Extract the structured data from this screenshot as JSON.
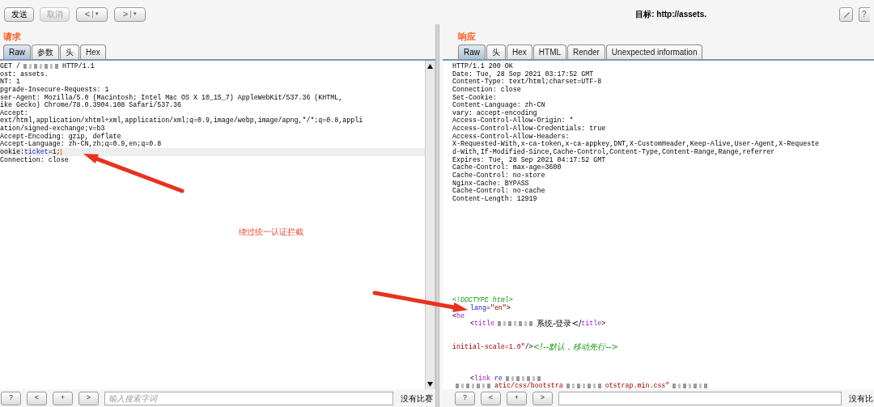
{
  "toolbar": {
    "buttons": [
      {
        "label": "发送",
        "disabled": false
      },
      {
        "label": "取消",
        "disabled": true
      }
    ],
    "nav": [
      {
        "label": "<",
        "menu": "▾"
      },
      {
        "label": ">",
        "menu": "▾"
      }
    ],
    "target": {
      "label": "目标:",
      "url": "http://assets."
    },
    "help": "?"
  },
  "request": {
    "title": "请求",
    "tabs": [
      {
        "label": "Raw",
        "selected": true
      },
      {
        "label": "参数",
        "selected": false
      },
      {
        "label": "头",
        "selected": false
      },
      {
        "label": "Hex",
        "selected": false
      }
    ],
    "lines": [
      {
        "kind": "code",
        "highlighted": false,
        "segments": [
          {
            "kind": "plain",
            "text": "GET /"
          },
          {
            "kind": "redacted"
          },
          {
            "kind": "plain",
            "text": "HTTP/1.1"
          }
        ]
      },
      {
        "kind": "code",
        "highlighted": false,
        "segments": [
          {
            "kind": "plain",
            "text": "ost: assets."
          }
        ]
      },
      {
        "kind": "code",
        "highlighted": false,
        "segments": [
          {
            "kind": "plain",
            "text": "NT: 1"
          }
        ]
      },
      {
        "kind": "code",
        "highlighted": false,
        "segments": [
          {
            "kind": "plain",
            "text": "pgrade-Insecure-Requests: 1"
          }
        ]
      },
      {
        "kind": "code",
        "highlighted": false,
        "segments": [
          {
            "kind": "plain",
            "text": "ser-Agent: Mozilla/5.0 (Macintosh; Intel Mac OS X 10_15_7) AppleWebKit/537.36 (KHTML,"
          }
        ]
      },
      {
        "kind": "code",
        "highlighted": false,
        "segments": [
          {
            "kind": "plain",
            "text": "ike Gecko) Chrome/78.0.3904.108 Safari/537.36"
          }
        ]
      },
      {
        "kind": "code",
        "highlighted": false,
        "segments": [
          {
            "kind": "plain",
            "text": "Accept:"
          }
        ]
      },
      {
        "kind": "code",
        "highlighted": false,
        "segments": [
          {
            "kind": "plain",
            "text": "ext/html,application/xhtml+xml,application/xml;q=0.9,image/webp,image/apng,*/*;q=0.8,appli"
          }
        ]
      },
      {
        "kind": "code",
        "highlighted": false,
        "segments": [
          {
            "kind": "plain",
            "text": "ation/signed-exchange;v=b3"
          }
        ]
      },
      {
        "kind": "code",
        "highlighted": false,
        "segments": [
          {
            "kind": "plain",
            "text": "Accept-Encoding: gzip, deflate"
          }
        ]
      },
      {
        "kind": "code",
        "highlighted": false,
        "segments": [
          {
            "kind": "plain",
            "text": "Accept-Language: zh-CN,zh;q=0.9,en;q=0.8"
          }
        ]
      },
      {
        "kind": "code",
        "highlighted": true,
        "segments": [
          {
            "kind": "plain",
            "text": "ookie:"
          },
          {
            "kind": "attr",
            "text": "ticket"
          },
          {
            "kind": "plain",
            "text": "=1;"
          }
        ]
      },
      {
        "kind": "code",
        "highlighted": false,
        "segments": [
          {
            "kind": "plain",
            "text": "Connection: close"
          }
        ]
      }
    ],
    "search": {
      "buttons": [
        "?",
        "<",
        "+",
        ">"
      ],
      "placeholder": "输入搜索字词",
      "status": "没有比赛"
    }
  },
  "response": {
    "title": "响应",
    "tabs": [
      {
        "label": "Raw",
        "selected": true
      },
      {
        "label": "头",
        "selected": false
      },
      {
        "label": "Hex",
        "selected": false
      },
      {
        "label": "HTML",
        "selected": false
      },
      {
        "label": "Render",
        "selected": false
      },
      {
        "label": "Unexpected information",
        "selected": false
      }
    ],
    "lines": [
      {
        "kind": "code",
        "segments": [
          {
            "kind": "plain",
            "text": "HTTP/1.1 200 OK"
          }
        ]
      },
      {
        "kind": "code",
        "segments": [
          {
            "kind": "plain",
            "text": "Date: Tue, 28 Sep 2021 03:17:52 GMT"
          }
        ]
      },
      {
        "kind": "code",
        "segments": [
          {
            "kind": "plain",
            "text": "Content-Type: text/html;charset=UTF-8"
          }
        ]
      },
      {
        "kind": "code",
        "segments": [
          {
            "kind": "plain",
            "text": "Connection: close"
          }
        ]
      },
      {
        "kind": "code",
        "segments": [
          {
            "kind": "plain",
            "text": "Set-Cookie:"
          }
        ]
      },
      {
        "kind": "code",
        "segments": [
          {
            "kind": "plain",
            "text": "Content-Language: zh-CN"
          }
        ]
      },
      {
        "kind": "code",
        "segments": [
          {
            "kind": "plain",
            "text": "vary: accept-encoding"
          }
        ]
      },
      {
        "kind": "code",
        "segments": [
          {
            "kind": "plain",
            "text": "Access-Control-Allow-Origin: *"
          }
        ]
      },
      {
        "kind": "code",
        "segments": [
          {
            "kind": "plain",
            "text": "Access-Control-Allow-Credentials: true"
          }
        ]
      },
      {
        "kind": "code",
        "segments": [
          {
            "kind": "plain",
            "text": "Access-Control-Allow-Headers:"
          }
        ]
      },
      {
        "kind": "code",
        "segments": [
          {
            "kind": "plain",
            "text": "X-Requested-With,x-ca-token,x-ca-appkey,DNT,X-CustomHeader,Keep-Alive,User-Agent,X-Requeste"
          }
        ]
      },
      {
        "kind": "code",
        "segments": [
          {
            "kind": "plain",
            "text": "d-With,If-Modified-Since,Cache-Control,Content-Type,Content-Range,Range,referrer"
          }
        ]
      },
      {
        "kind": "code",
        "segments": [
          {
            "kind": "plain",
            "text": "Expires: Tue, 28 Sep 2021 04:17:52 GMT"
          }
        ]
      },
      {
        "kind": "code",
        "segments": [
          {
            "kind": "plain",
            "text": "Cache-Control: max-age=3600"
          }
        ]
      },
      {
        "kind": "code",
        "segments": [
          {
            "kind": "plain",
            "text": "Cache-Control: no-store"
          }
        ]
      },
      {
        "kind": "code",
        "segments": [
          {
            "kind": "plain",
            "text": "Nginx-Cache: BYPASS"
          }
        ]
      },
      {
        "kind": "code",
        "segments": [
          {
            "kind": "plain",
            "text": "Cache-Control: no-cache"
          }
        ]
      },
      {
        "kind": "code",
        "segments": [
          {
            "kind": "plain",
            "text": "Content-Length: 12919"
          }
        ]
      },
      {
        "kind": "blank"
      },
      {
        "kind": "blank"
      },
      {
        "kind": "blank"
      },
      {
        "kind": "blank"
      },
      {
        "kind": "blank"
      },
      {
        "kind": "blank"
      },
      {
        "kind": "blank"
      },
      {
        "kind": "blank"
      },
      {
        "kind": "blank"
      },
      {
        "kind": "blank"
      },
      {
        "kind": "blank"
      },
      {
        "kind": "blank"
      },
      {
        "kind": "code",
        "segments": [
          {
            "kind": "comment",
            "text": "<!DOCTYPE html>"
          }
        ]
      },
      {
        "kind": "code-indented",
        "segments": [
          {
            "kind": "attr",
            "text": "lang"
          },
          {
            "kind": "plain",
            "text": "="
          },
          {
            "kind": "string",
            "text": "\"en\""
          },
          {
            "kind": "plain",
            "text": ">"
          }
        ]
      },
      {
        "kind": "code",
        "segments": [
          {
            "kind": "plain",
            "text": "<"
          },
          {
            "kind": "tag",
            "text": "he"
          }
        ]
      },
      {
        "kind": "code-indented",
        "segments": [
          {
            "kind": "plain",
            "text": "<"
          },
          {
            "kind": "tag",
            "text": "title"
          },
          {
            "kind": "redacted"
          },
          {
            "kind": "plain",
            "text": "系统-登录</",
            "cjk": true
          },
          {
            "kind": "tag",
            "text": "title"
          },
          {
            "kind": "plain",
            "text": ">"
          }
        ]
      },
      {
        "kind": "blank"
      },
      {
        "kind": "blank"
      },
      {
        "kind": "code",
        "segments": [
          {
            "kind": "string",
            "text": "initial-scale=1.0\""
          },
          {
            "kind": "plain",
            "text": "/>"
          },
          {
            "kind": "comment",
            "text": "<!--默认，移动先行-->",
            "cjk": true
          }
        ]
      },
      {
        "kind": "blank"
      },
      {
        "kind": "blank"
      },
      {
        "kind": "blank"
      },
      {
        "kind": "code-indented",
        "segments": [
          {
            "kind": "plain",
            "text": "<"
          },
          {
            "kind": "tag",
            "text": "link "
          },
          {
            "kind": "attr",
            "text": "re"
          },
          {
            "kind": "redacted"
          }
        ]
      },
      {
        "kind": "code",
        "segments": [
          {
            "kind": "redacted"
          },
          {
            "kind": "string",
            "text": "atic/css/bootstra"
          },
          {
            "kind": "redacted"
          },
          {
            "kind": "string",
            "text": "otstrap.min.css\""
          },
          {
            "kind": "redacted"
          }
        ]
      }
    ],
    "search": {
      "buttons": [
        "?",
        "<",
        "+",
        ">"
      ],
      "status": "没有比"
    }
  },
  "annotation": {
    "text": "绕过统一认证拦截"
  }
}
